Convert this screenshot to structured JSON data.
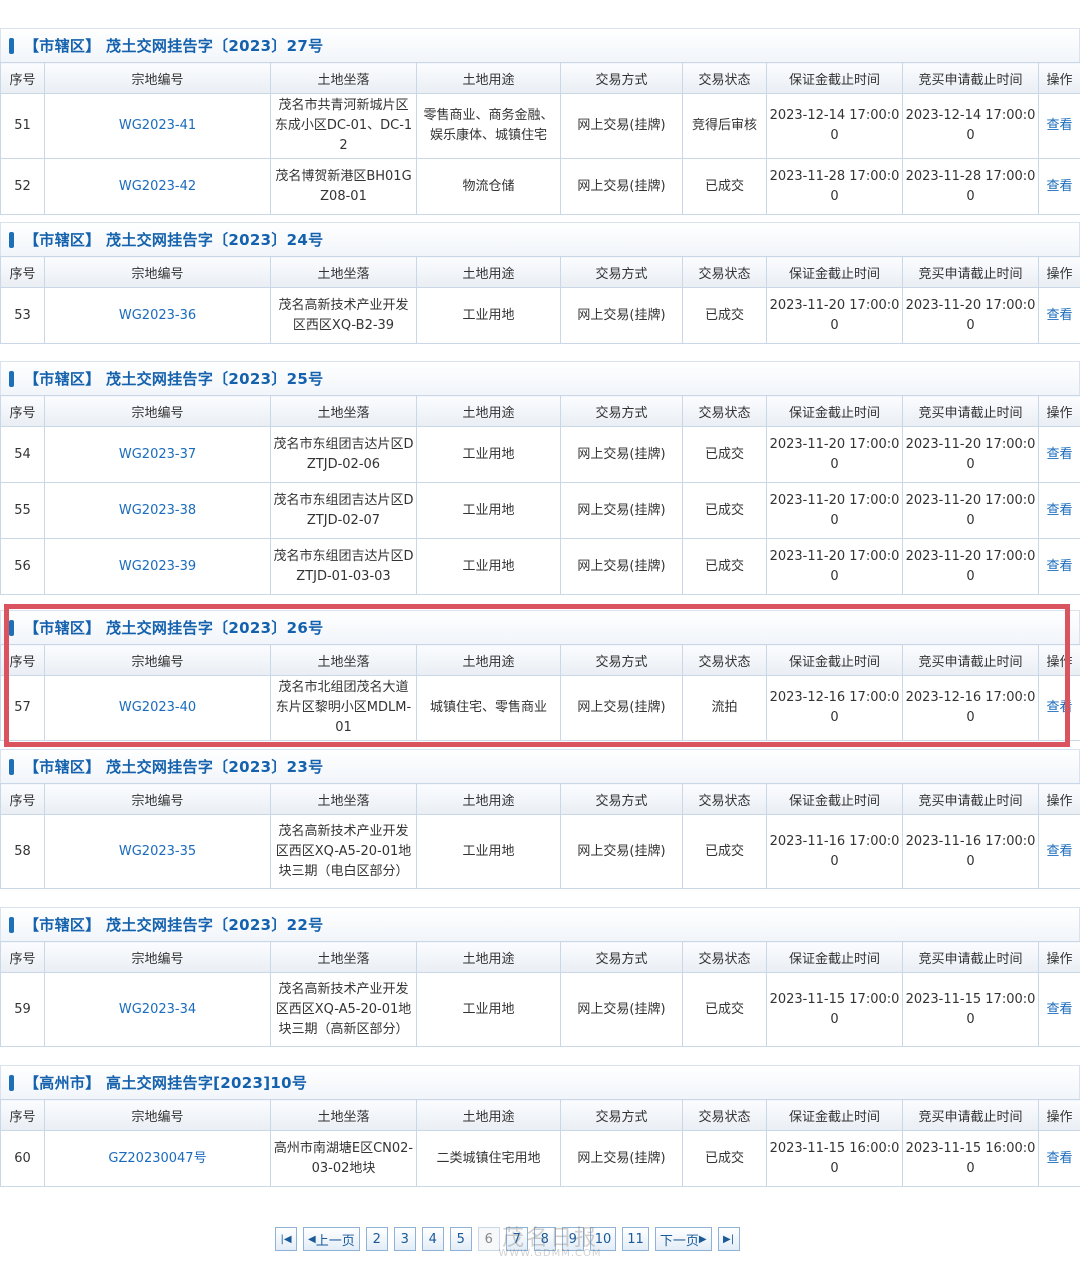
{
  "columns": [
    "序号",
    "宗地编号",
    "土地坐落",
    "土地用途",
    "交易方式",
    "交易状态",
    "保证金截止时间",
    "竞买申请截止时间",
    "操作"
  ],
  "sections": [
    {
      "title": "【市辖区】 茂土交网挂告字〔2023〕27号",
      "rows": [
        {
          "no": "51",
          "code": "WG2023-41",
          "location": "茂名市共青河新城片区东成小区DC-01、DC-12",
          "use": "零售商业、商务金融、娱乐康体、城镇住宅",
          "method": "网上交易(挂牌)",
          "status": "竞得后审核",
          "deposit_deadline": "2023-12-14 17:00:00",
          "apply_deadline": "2023-12-14 17:00:00",
          "action": "查看"
        },
        {
          "no": "52",
          "code": "WG2023-42",
          "location": "茂名博贺新港区BH01GZ08-01",
          "use": "物流仓储",
          "method": "网上交易(挂牌)",
          "status": "已成交",
          "deposit_deadline": "2023-11-28 17:00:00",
          "apply_deadline": "2023-11-28 17:00:00",
          "action": "查看"
        }
      ]
    },
    {
      "title": "【市辖区】 茂土交网挂告字〔2023〕24号",
      "rows": [
        {
          "no": "53",
          "code": "WG2023-36",
          "location": "茂名高新技术产业开发区西区XQ-B2-39",
          "use": "工业用地",
          "method": "网上交易(挂牌)",
          "status": "已成交",
          "deposit_deadline": "2023-11-20 17:00:00",
          "apply_deadline": "2023-11-20 17:00:00",
          "action": "查看"
        }
      ]
    },
    {
      "title": "【市辖区】 茂土交网挂告字〔2023〕25号",
      "rows": [
        {
          "no": "54",
          "code": "WG2023-37",
          "location": "茂名市东组团吉达片区DZTJD-02-06",
          "use": "工业用地",
          "method": "网上交易(挂牌)",
          "status": "已成交",
          "deposit_deadline": "2023-11-20 17:00:00",
          "apply_deadline": "2023-11-20 17:00:00",
          "action": "查看"
        },
        {
          "no": "55",
          "code": "WG2023-38",
          "location": "茂名市东组团吉达片区DZTJD-02-07",
          "use": "工业用地",
          "method": "网上交易(挂牌)",
          "status": "已成交",
          "deposit_deadline": "2023-11-20 17:00:00",
          "apply_deadline": "2023-11-20 17:00:00",
          "action": "查看"
        },
        {
          "no": "56",
          "code": "WG2023-39",
          "location": "茂名市东组团吉达片区DZTJD-01-03-03",
          "use": "工业用地",
          "method": "网上交易(挂牌)",
          "status": "已成交",
          "deposit_deadline": "2023-11-20 17:00:00",
          "apply_deadline": "2023-11-20 17:00:00",
          "action": "查看"
        }
      ]
    },
    {
      "title": "【市辖区】 茂土交网挂告字〔2023〕26号",
      "rows": [
        {
          "no": "57",
          "code": "WG2023-40",
          "location": "茂名市北组团茂名大道东片区黎明小区MDLM-01",
          "use": "城镇住宅、零售商业",
          "method": "网上交易(挂牌)",
          "status": "流拍",
          "deposit_deadline": "2023-12-16 17:00:00",
          "apply_deadline": "2023-12-16 17:00:00",
          "action": "查看"
        }
      ]
    },
    {
      "title": "【市辖区】 茂土交网挂告字〔2023〕23号",
      "rows": [
        {
          "no": "58",
          "code": "WG2023-35",
          "location": "茂名高新技术产业开发区西区XQ-A5-20-01地块三期（电白区部分）",
          "use": "工业用地",
          "method": "网上交易(挂牌)",
          "status": "已成交",
          "deposit_deadline": "2023-11-16 17:00:00",
          "apply_deadline": "2023-11-16 17:00:00",
          "action": "查看"
        }
      ]
    },
    {
      "title": "【市辖区】 茂土交网挂告字〔2023〕22号",
      "rows": [
        {
          "no": "59",
          "code": "WG2023-34",
          "location": "茂名高新技术产业开发区西区XQ-A5-20-01地块三期（高新区部分）",
          "use": "工业用地",
          "method": "网上交易(挂牌)",
          "status": "已成交",
          "deposit_deadline": "2023-11-15 17:00:00",
          "apply_deadline": "2023-11-15 17:00:00",
          "action": "查看"
        }
      ]
    },
    {
      "title": "【高州市】 高土交网挂告字[2023]10号",
      "rows": [
        {
          "no": "60",
          "code": "GZ20230047号",
          "location": "高州市南湖塘E区CN02-03-02地块",
          "use": "二类城镇住宅用地",
          "method": "网上交易(挂牌)",
          "status": "已成交",
          "deposit_deadline": "2023-11-15 16:00:00",
          "apply_deadline": "2023-11-15 16:00:00",
          "action": "查看"
        }
      ]
    }
  ],
  "pagination": {
    "first_icon": "first-page-icon",
    "prev_label": "上一页",
    "pages": [
      "2",
      "3",
      "4",
      "5",
      "6",
      "7",
      "8",
      "9",
      "10",
      "11"
    ],
    "current_page": "6",
    "next_label": "下一页",
    "last_icon": "last-page-icon"
  },
  "watermark": {
    "main": "茂名日报",
    "sub": "WWW.GDMM.COM"
  },
  "colors": {
    "accent": "#1461ad",
    "link": "#1a6bbd",
    "highlight": "#d9545e",
    "border": "#c9d7e6"
  }
}
